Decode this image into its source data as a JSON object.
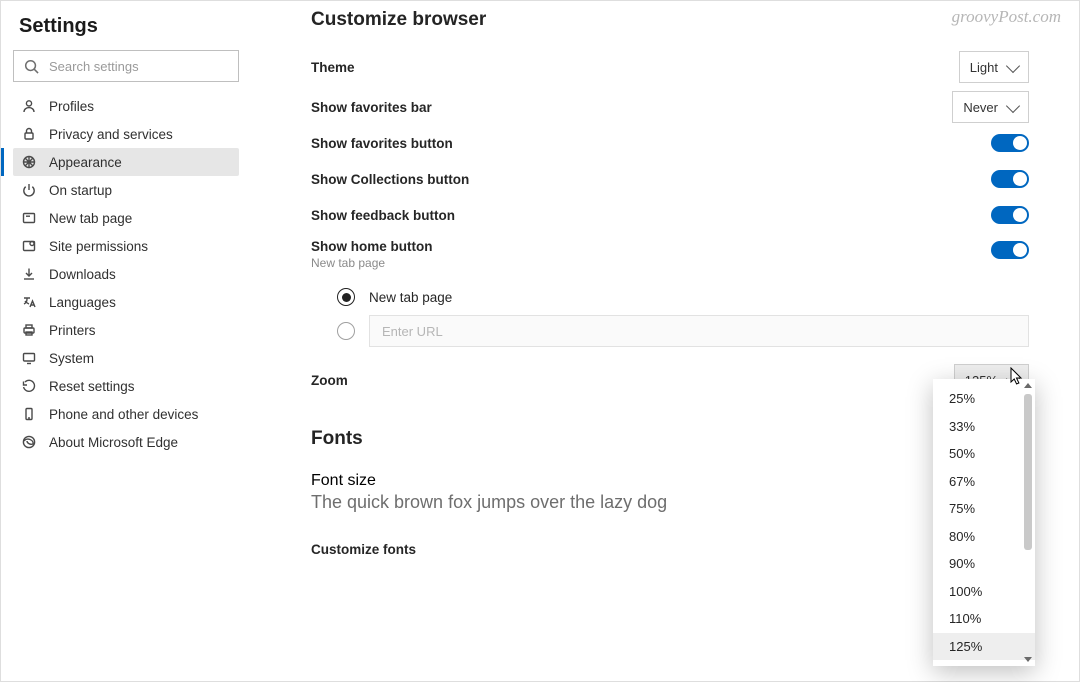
{
  "watermark": "groovyPost.com",
  "sidebar": {
    "title": "Settings",
    "search_placeholder": "Search settings",
    "items": [
      {
        "label": "Profiles"
      },
      {
        "label": "Privacy and services"
      },
      {
        "label": "Appearance"
      },
      {
        "label": "On startup"
      },
      {
        "label": "New tab page"
      },
      {
        "label": "Site permissions"
      },
      {
        "label": "Downloads"
      },
      {
        "label": "Languages"
      },
      {
        "label": "Printers"
      },
      {
        "label": "System"
      },
      {
        "label": "Reset settings"
      },
      {
        "label": "Phone and other devices"
      },
      {
        "label": "About Microsoft Edge"
      }
    ]
  },
  "main": {
    "section_title": "Customize browser",
    "theme": {
      "label": "Theme",
      "value": "Light"
    },
    "fav_bar": {
      "label": "Show favorites bar",
      "value": "Never"
    },
    "fav_btn": {
      "label": "Show favorites button",
      "on": true
    },
    "collections_btn": {
      "label": "Show Collections button",
      "on": true
    },
    "feedback_btn": {
      "label": "Show feedback button",
      "on": true
    },
    "home_btn": {
      "label": "Show home button",
      "sub": "New tab page",
      "on": true
    },
    "home_radio": {
      "new_tab_label": "New tab page",
      "url_placeholder": "Enter URL",
      "selected": "new_tab"
    },
    "zoom": {
      "label": "Zoom",
      "value": "125%",
      "options": [
        "25%",
        "33%",
        "50%",
        "67%",
        "75%",
        "80%",
        "90%",
        "100%",
        "110%",
        "125%"
      ]
    },
    "fonts": {
      "title": "Fonts",
      "size_label": "Font size",
      "sample": "The quick brown fox jumps over the lazy dog",
      "customize_label": "Customize fonts"
    }
  }
}
